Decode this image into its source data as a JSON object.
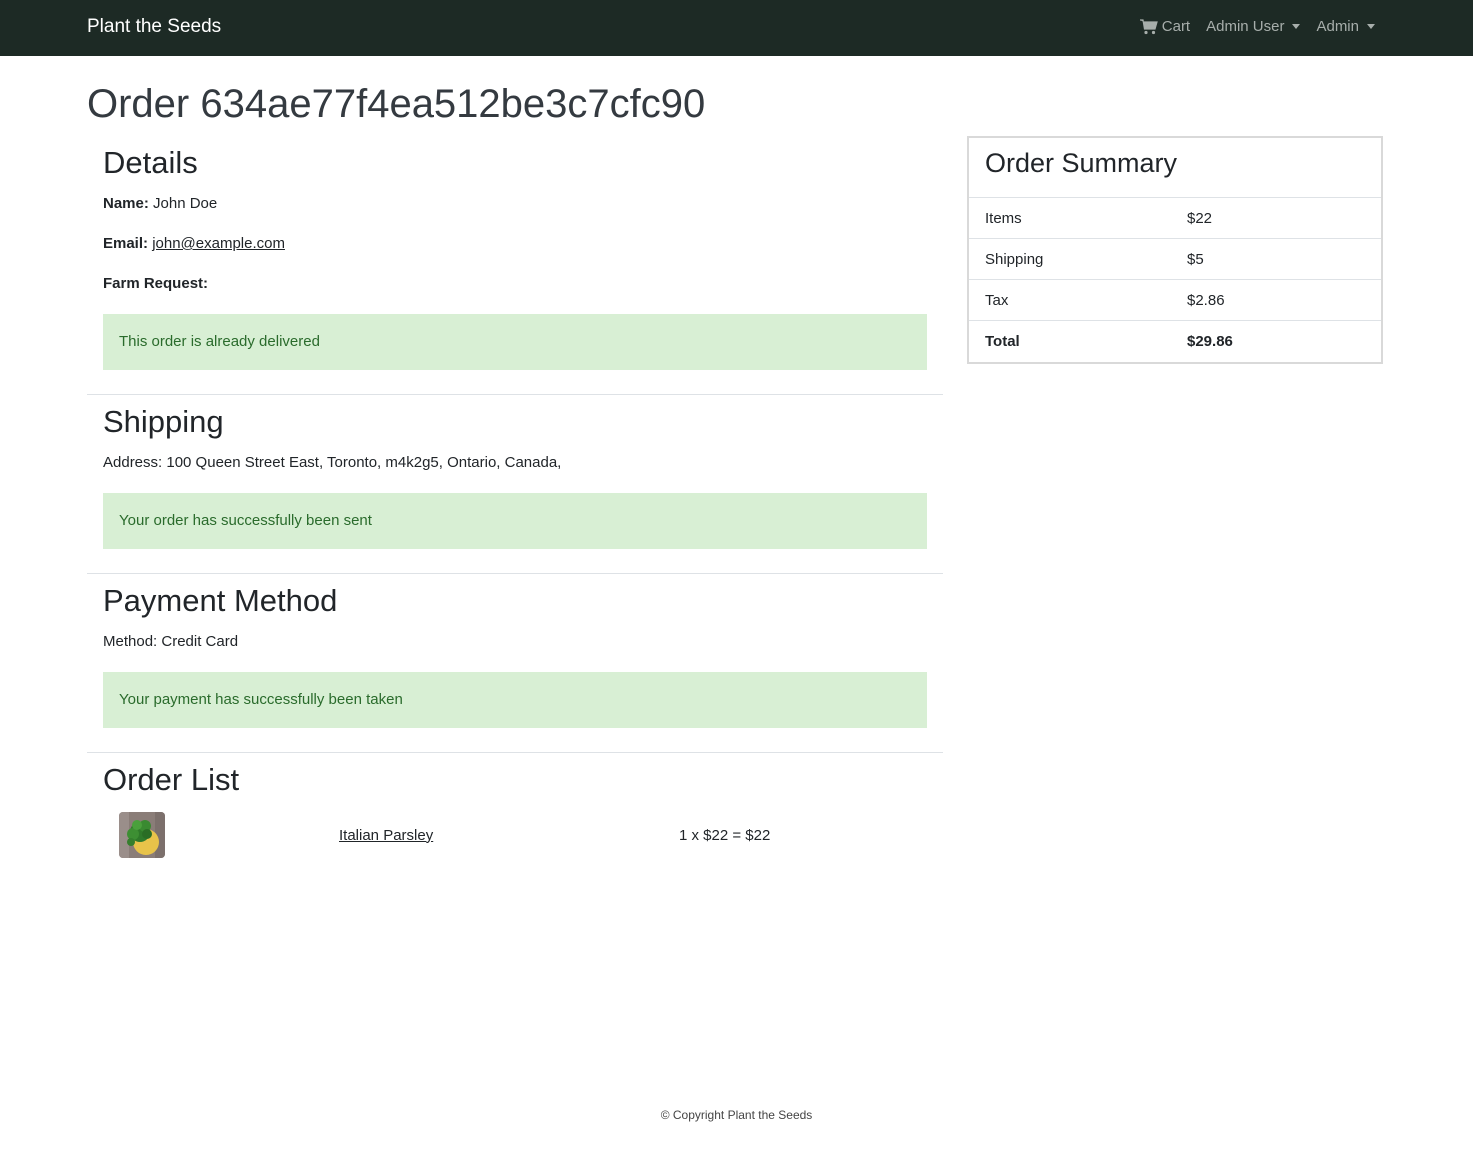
{
  "navbar": {
    "brand": "Plant the Seeds",
    "cart_label": "Cart",
    "user_menu_label": "Admin User",
    "admin_menu_label": "Admin"
  },
  "page": {
    "title": "Order 634ae77f4ea512be3c7cfc90"
  },
  "details": {
    "heading": "Details",
    "name_label": "Name:",
    "name_value": "John Doe",
    "email_label": "Email:",
    "email_value": "john@example.com",
    "farm_label": "Farm Request:",
    "alert": "This order is already delivered"
  },
  "shipping": {
    "heading": "Shipping",
    "address": "Address: 100 Queen Street East, Toronto, m4k2g5, Ontario, Canada,",
    "alert": "Your order has successfully been sent"
  },
  "payment": {
    "heading": "Payment Method",
    "method": "Method: Credit Card",
    "alert": "Your payment has successfully been taken"
  },
  "order_list": {
    "heading": "Order List",
    "items": [
      {
        "name": "Italian Parsley",
        "price_line": "1 x $22 = $22"
      }
    ]
  },
  "summary": {
    "heading": "Order Summary",
    "rows": [
      {
        "label": "Items",
        "value": "$22"
      },
      {
        "label": "Shipping",
        "value": "$5"
      },
      {
        "label": "Tax",
        "value": "$2.86"
      },
      {
        "label": "Total",
        "value": "$29.86"
      }
    ]
  },
  "footer": {
    "text": "© Copyright Plant the Seeds"
  }
}
